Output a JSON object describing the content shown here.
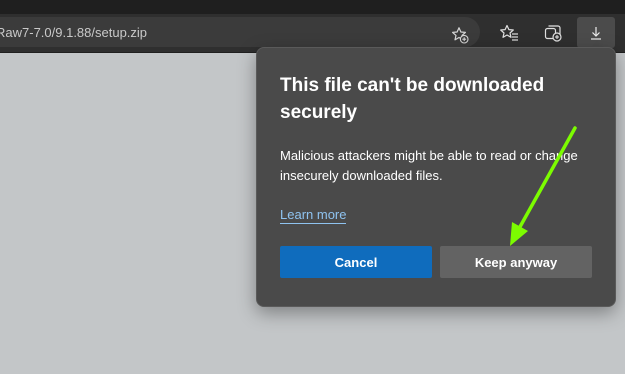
{
  "browser": {
    "address_text": "Raw7-7.0/9.1.88/setup.zip"
  },
  "icons": {
    "address_favorite": "star-add-icon",
    "favorites": "favorites-icon",
    "collections": "collections-icon",
    "downloads": "download-icon",
    "annotation": "green-arrow-annotation"
  },
  "popup": {
    "title": "This file can't be downloaded securely",
    "body": "Malicious attackers might be able to read or change insecurely downloaded files.",
    "learn_more": "Learn more",
    "cancel_label": "Cancel",
    "keep_label": "Keep anyway"
  },
  "colors": {
    "page_background": "#c3c6c8",
    "toolbar": "#2f2f2f",
    "popup_background": "#4a4a4a",
    "primary_button": "#0f6cbd",
    "secondary_button": "#636363",
    "link": "#8fc3f0",
    "annotation_arrow": "#7cfc00"
  }
}
